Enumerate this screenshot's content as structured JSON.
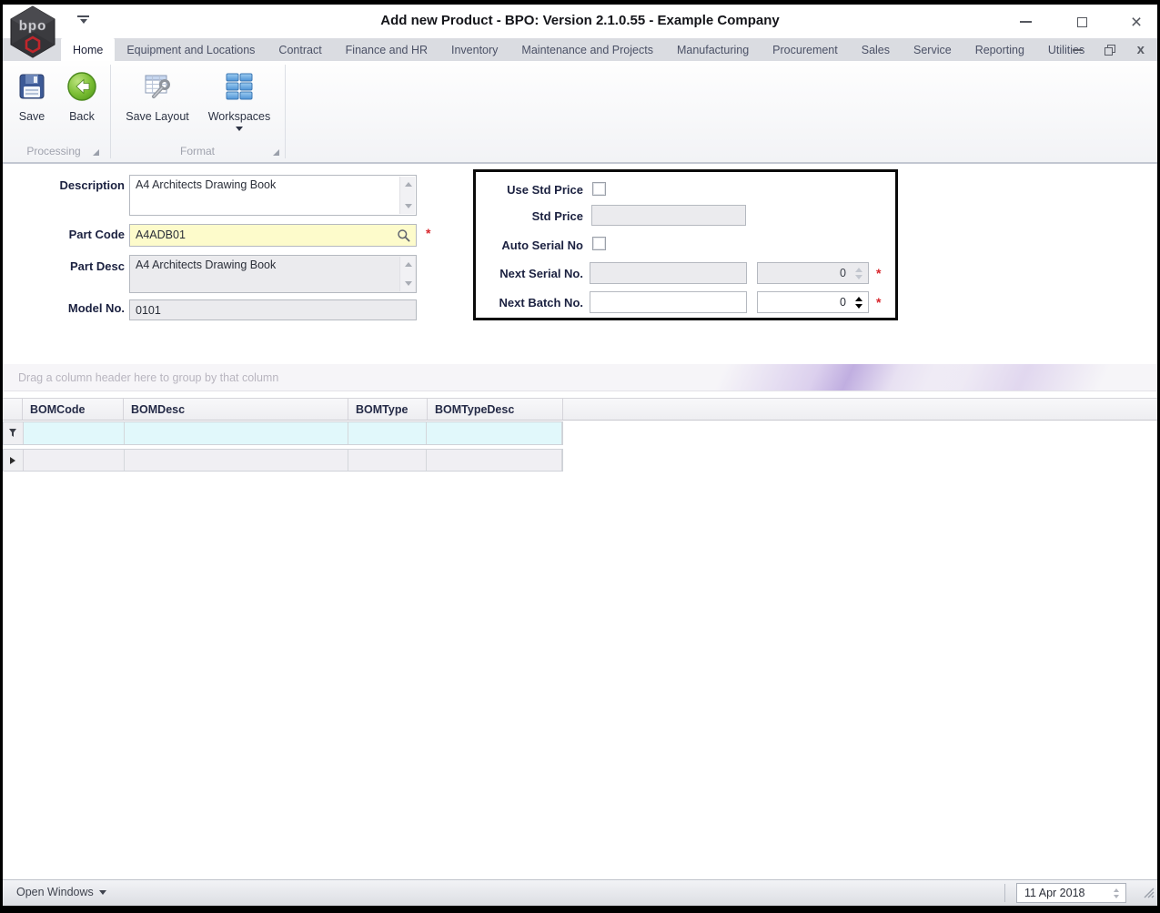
{
  "colors": {
    "part_code_yellow": "#FDFBCB",
    "required_red": "#D8262C",
    "filter_row_cyan": "#E1F8FB",
    "label_navy": "#1B2140",
    "group_swoosh_purple": "#9474CD"
  },
  "window": {
    "title": "Add new Product - BPO: Version 2.1.0.55 - Example Company",
    "logo_text": "bpo"
  },
  "tabs": [
    {
      "label": "Home"
    },
    {
      "label": "Equipment and Locations"
    },
    {
      "label": "Contract"
    },
    {
      "label": "Finance and HR"
    },
    {
      "label": "Inventory"
    },
    {
      "label": "Maintenance and Projects"
    },
    {
      "label": "Manufacturing"
    },
    {
      "label": "Procurement"
    },
    {
      "label": "Sales"
    },
    {
      "label": "Service"
    },
    {
      "label": "Reporting"
    },
    {
      "label": "Utilities"
    }
  ],
  "ribbon": {
    "save_label": "Save",
    "back_label": "Back",
    "save_layout_label": "Save Layout",
    "workspaces_label": "Workspaces",
    "group_processing": "Processing",
    "group_format": "Format"
  },
  "form": {
    "description_label": "Description",
    "description_value": "A4 Architects Drawing Book",
    "part_code_label": "Part Code",
    "part_code_value": "A4ADB01",
    "part_desc_label": "Part Desc",
    "part_desc_value": "A4 Architects Drawing Book",
    "model_no_label": "Model No.",
    "model_no_value": "0101",
    "required_marker": "*"
  },
  "pricing_panel": {
    "use_std_price_label": "Use Std Price",
    "std_price_label": "Std Price",
    "std_price_value": "",
    "auto_serial_label": "Auto Serial No",
    "next_serial_label": "Next Serial No.",
    "next_serial_value": "",
    "next_serial_count": "0",
    "next_batch_label": "Next Batch No.",
    "next_batch_value": "",
    "next_batch_count": "0",
    "required_marker": "*"
  },
  "grid": {
    "group_hint": "Drag a column header here to group by that column",
    "columns": [
      {
        "label": "BOMCode"
      },
      {
        "label": "BOMDesc"
      },
      {
        "label": "BOMType"
      },
      {
        "label": "BOMTypeDesc"
      }
    ]
  },
  "statusbar": {
    "open_windows_label": "Open Windows",
    "date_value": "11 Apr 2018"
  }
}
